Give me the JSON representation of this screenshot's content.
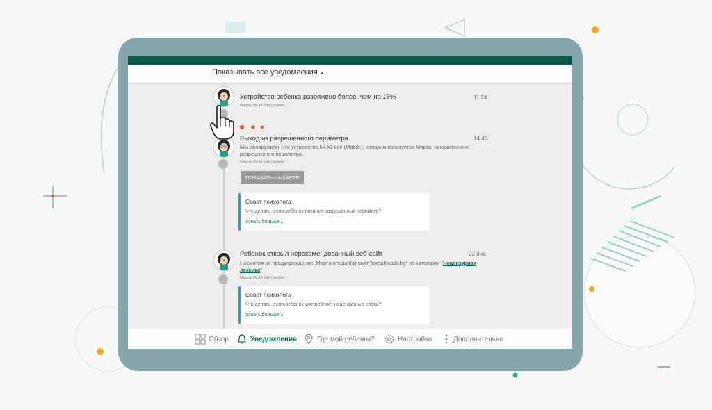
{
  "filter": {
    "label": "Показывать все уведомления"
  },
  "notifications": [
    {
      "title": "Устройство ребенка разряжено более, чем на 15%",
      "time": "11:24",
      "sub": "Марта, Mi A2 Lite (Mobile)"
    },
    {
      "title": "Выход из разрешенного периметра",
      "time": "14:45",
      "body": "Мы обнаружили, что устройство Mi A2 Lite (Mobile), которым пользуется Марта, находится вне разрешенного периметра.",
      "sub": "Марта, Mi A2 Lite (Mobile)",
      "button": "ПОКАЗАТЬ НА КАРТЕ",
      "tip": {
        "title": "Совет психолога",
        "text": "Что делать, если ребенок покинул разрешенный периметр?",
        "link": "Узнать больше..."
      }
    },
    {
      "title": "Ребенок открыл нерекомендованный веб-сайт",
      "time": "23 янв.",
      "body_prefix": "Несмотря на предупреждение, Марта открыл(а) сайт \"metalheads.by\" из категории \"",
      "body_link": "Нецензурная лексика",
      "body_suffix": "\"",
      "sub": "Марта, Mi A2 Lite (Mobile)",
      "tip": {
        "title": "Совет психолога",
        "text": "Что делать, если ребенок употребляет нецензурные слова?",
        "link": "Узнать больше..."
      }
    }
  ],
  "nav": {
    "overview": "Обзор",
    "notifications": "Уведомления",
    "where": "Где мой ребенок?",
    "settings": "Настройка",
    "more": "Дополнительно"
  },
  "colors": {
    "accent": "#0b6b55",
    "topbar": "#0d5a4a",
    "tip_border": "#2d9fd0",
    "tablet": "#86a4ab",
    "dots": "#e8531f"
  },
  "icons": [
    "grid-icon",
    "bell-icon",
    "map-pin-icon",
    "gear-icon",
    "more-vertical-icon",
    "hand-pointer-icon"
  ]
}
